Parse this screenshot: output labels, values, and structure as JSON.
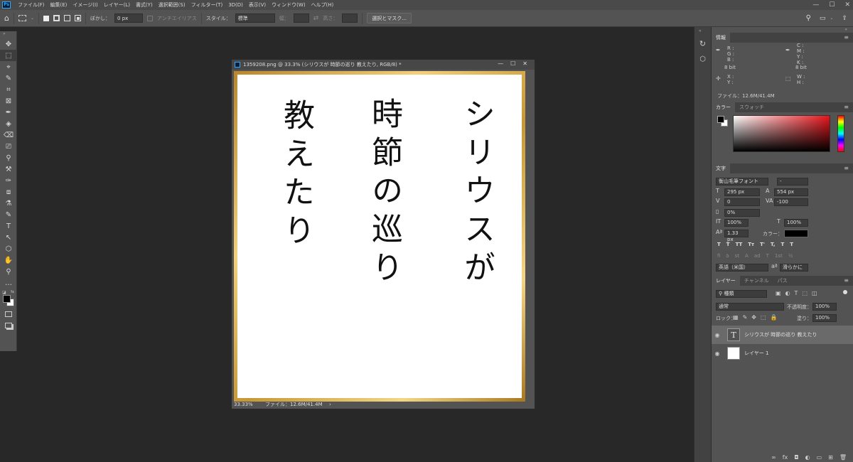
{
  "menubar": {
    "logo": "Ps",
    "items": [
      "ファイル(F)",
      "編集(E)",
      "イメージ(I)",
      "レイヤー(L)",
      "書式(Y)",
      "選択範囲(S)",
      "フィルター(T)",
      "3D(D)",
      "表示(V)",
      "ウィンドウ(W)",
      "ヘルプ(H)"
    ],
    "window_buttons": [
      "—",
      "☐",
      "✕"
    ]
  },
  "options": {
    "blur_label": "ぼかし：",
    "blur_value": "0 px",
    "antialias_label": "アンチエイリアス",
    "style_label": "スタイル：",
    "style_value": "標準",
    "width_label": "幅：",
    "height_label": "高さ：",
    "select_mask_button": "選択とマスク..."
  },
  "document": {
    "title": "1359208.png @ 33.3% (シリウスが 時節の巡り 教えたり, RGB/8) *",
    "col1": "シリウスが",
    "col2": "時節の巡り",
    "col3": "教えたり",
    "zoom": "33.33%",
    "file_info": "ファイル：12.6M/41.4M",
    "status_arrow": "›",
    "frame_color": "#d4a540"
  },
  "info_panel": {
    "tab": "情報",
    "rgb": [
      "R :",
      "G :",
      "B :"
    ],
    "cmyk": [
      "C :",
      "M :",
      "Y :",
      "K :"
    ],
    "bit_left": "8 bit",
    "bit_right": "8 bit",
    "xy": [
      "X :",
      "Y :"
    ],
    "wh": [
      "W :",
      "H :"
    ],
    "file": "ファイル：12.6M/41.4M"
  },
  "color_panel": {
    "tabs": [
      "カラー",
      "スウォッチ"
    ]
  },
  "character_panel": {
    "tab": "文字",
    "font": "衡山毛筆フォント",
    "style": "-",
    "size": "295 px",
    "leading": "554 px",
    "kerning": "0",
    "tracking": "-100",
    "tsume": "0%",
    "vscale": "100%",
    "hscale": "100%",
    "baseline": "1.33 px",
    "color_label": "カラー：",
    "language": "英語（米国）",
    "antialias": "滑らかに",
    "style_buttons": [
      "T",
      "T",
      "TT",
      "Tт",
      "T'",
      "T,",
      "T",
      "T"
    ],
    "ot_buttons": [
      "fi",
      "ꝺ",
      "st",
      "A",
      "ad",
      "T",
      "1st",
      "½"
    ]
  },
  "layers_panel": {
    "tabs": [
      "レイヤー",
      "チャンネル",
      "パス"
    ],
    "kind": "種類",
    "blend": "通常",
    "opacity_label": "不透明度：",
    "opacity": "100%",
    "lock_label": "ロック：",
    "fill_label": "塗り：",
    "fill": "100%",
    "layers": [
      {
        "name": "シリウスが 時節の巡り 教えたり",
        "thumb": "T",
        "selected": true
      },
      {
        "name": "レイヤー 1",
        "thumb": "",
        "selected": false
      }
    ],
    "bottom_icons": [
      "∞",
      "fx",
      "◘",
      "◐",
      "▭",
      "⊞",
      "🗑"
    ]
  },
  "tools": [
    "✥",
    "⬚",
    "⌖",
    "✎",
    "⌗",
    "⊠",
    "✒",
    "◈",
    "⌫",
    "⎚",
    "⚲",
    "⚒",
    "✑",
    "⧈",
    "⚗",
    "✎",
    "⌀",
    "T",
    "↖",
    "⬡",
    "✋",
    "⚲",
    "…"
  ]
}
